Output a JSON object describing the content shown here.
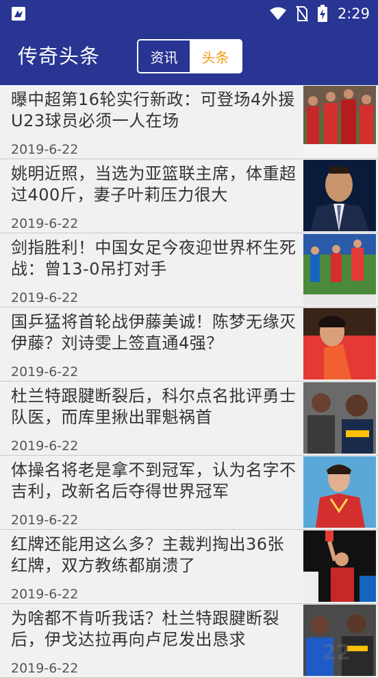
{
  "status_bar": {
    "time": "2:29",
    "icons": [
      "app-notification-icon",
      "wifi-icon",
      "no-sim-icon",
      "battery-charging-icon"
    ]
  },
  "app_bar": {
    "title": "传奇头条",
    "tabs": [
      {
        "label": "资讯",
        "selected": false
      },
      {
        "label": "头条",
        "selected": true
      }
    ]
  },
  "colors": {
    "primary": "#283593",
    "accent": "#f39c12"
  },
  "news": [
    {
      "title": "曝中超第16轮实行新政：可登场4外援 U23球员必须一人在场",
      "date": "2019-6-22",
      "image": "soccer-team-photo"
    },
    {
      "title": "姚明近照，当选为亚篮联主席，体重超过400斤，妻子叶莉压力很大",
      "date": "2019-6-22",
      "image": "yao-ming-photo"
    },
    {
      "title": "剑指胜利！中国女足今夜迎世界杯生死战：曾13-0吊打对手",
      "date": "2019-6-22",
      "image": "womens-soccer-photo"
    },
    {
      "title": "国乒猛将首轮战伊藤美诚！陈梦无缘灭伊藤？刘诗雯上签直通4强？",
      "date": "2019-6-22",
      "image": "table-tennis-player-photo"
    },
    {
      "title": "杜兰特跟腱断裂后，科尔点名批评勇士队医，而库里揪出罪魁祸首",
      "date": "2019-6-22",
      "image": "basketball-players-photo"
    },
    {
      "title": "体操名将老是拿不到冠军，认为名字不吉利，改新名后夺得世界冠军",
      "date": "2019-6-22",
      "image": "gymnast-photo"
    },
    {
      "title": "红牌还能用这么多？主裁判掏出36张红牌，双方教练都崩溃了",
      "date": "2019-6-22",
      "image": "referee-red-card-photo"
    },
    {
      "title": "为啥都不肯听我话？杜兰特跟腱断裂后，伊戈达拉再向卢尼发出恳求",
      "date": "2019-6-22",
      "image": "warriors-players-photo"
    }
  ],
  "watermark": "22"
}
